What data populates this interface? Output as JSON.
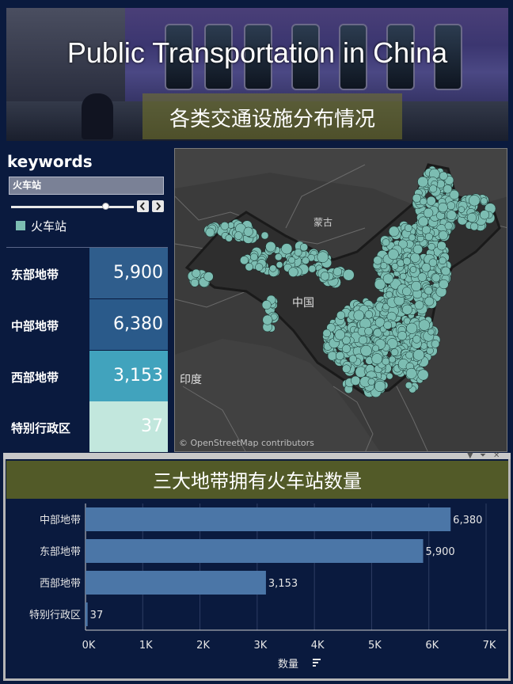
{
  "header": {
    "title": "Public Transportation in China",
    "subtitle": "各类交通设施分布情况"
  },
  "filter": {
    "heading": "keywords",
    "selected": "火车站",
    "prev_icon": "chevron-left-icon",
    "next_icon": "chevron-right-icon",
    "legend_label": "火车站",
    "legend_color": "#7cbdb2"
  },
  "regions": [
    {
      "label": "东部地带",
      "value": "5,900",
      "color": "#2f5d8c"
    },
    {
      "label": "中部地带",
      "value": "6,380",
      "color": "#2a5a8a"
    },
    {
      "label": "西部地带",
      "value": "3,153",
      "color": "#41a3bd"
    },
    {
      "label": "特别行政区",
      "value": "37",
      "color": "#c2e7dd"
    }
  ],
  "map": {
    "labels": {
      "mongolia": "蒙古",
      "china": "中国",
      "india": "印度"
    },
    "credit": "© OpenStreetMap contributors",
    "point_color": "#7cbdb2"
  },
  "chart_data": {
    "type": "bar",
    "title": "三大地带拥有火车站数量",
    "orientation": "horizontal",
    "categories": [
      "中部地带",
      "东部地带",
      "西部地带",
      "特别行政区"
    ],
    "values": [
      6380,
      5900,
      3153,
      37
    ],
    "value_labels": [
      "6,380",
      "5,900",
      "3,153",
      "37"
    ],
    "xlabel": "数量",
    "xlim": [
      0,
      7000
    ],
    "xticks": [
      "0K",
      "1K",
      "2K",
      "3K",
      "4K",
      "5K",
      "6K",
      "7K"
    ],
    "bar_color": "#4b76a7",
    "grid": true
  }
}
